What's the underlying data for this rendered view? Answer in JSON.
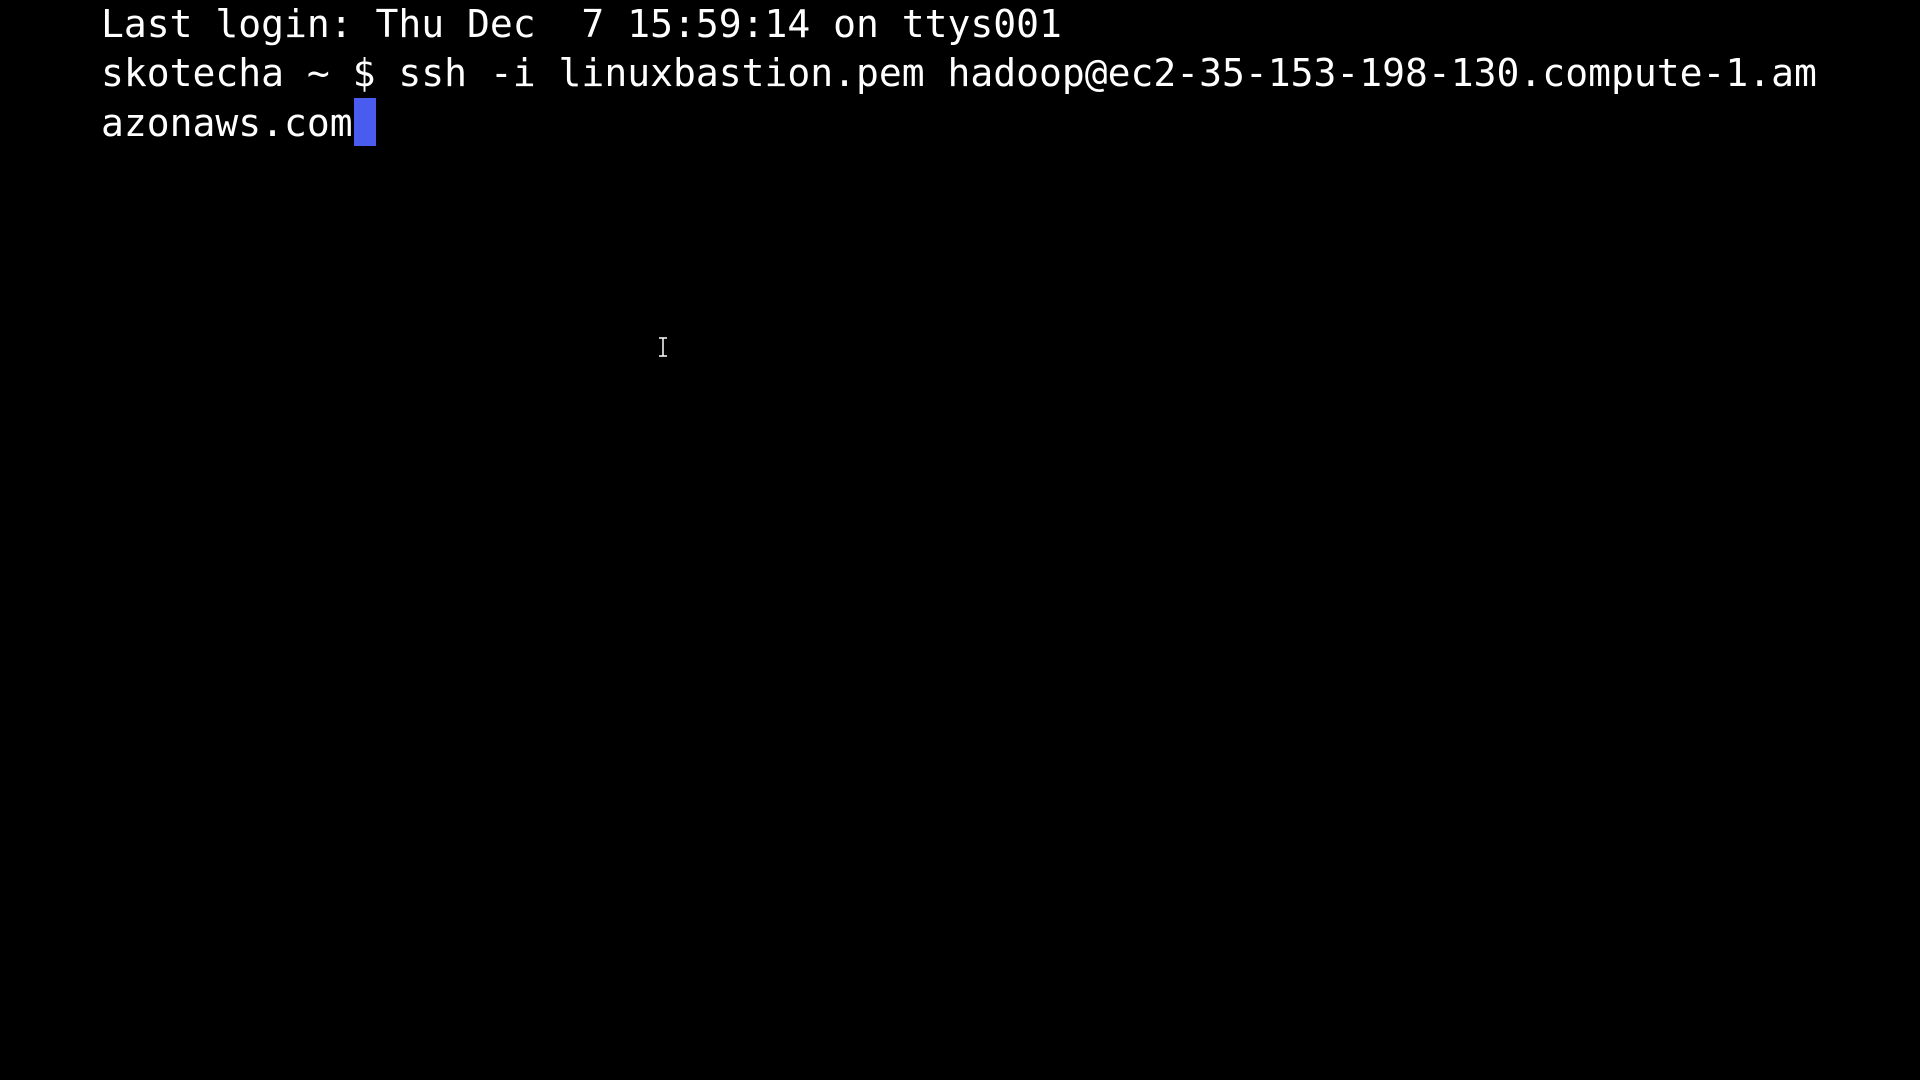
{
  "terminal": {
    "background_color": "#000000",
    "text_color": "#ffffff",
    "cursor_color": "#4a5cf0",
    "lines": [
      "Last login: Thu Dec  7 15:59:14 on ttys001",
      "skotecha ~ $ ssh -i linuxbastion.pem hadoop@ec2-35-153-198-130.compute-1.am",
      "azonaws.com"
    ]
  },
  "pointer": {
    "icon": "ibeam-cursor-icon"
  }
}
